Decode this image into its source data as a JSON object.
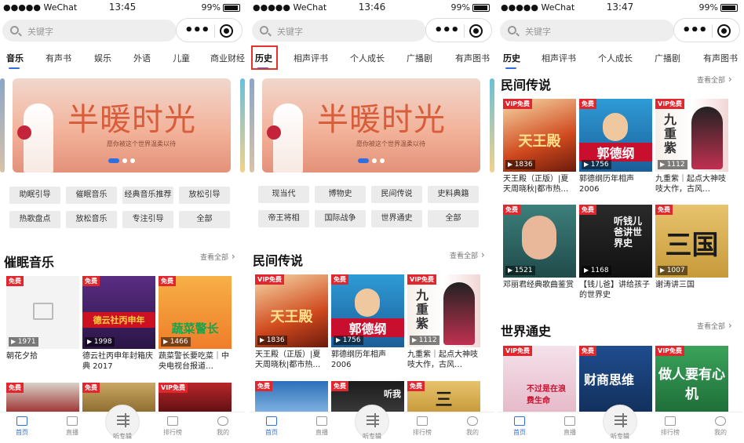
{
  "status": {
    "carrier": "●●●●● WeChat",
    "wifi": "wifi-icon",
    "battery": "99%"
  },
  "screens": [
    {
      "time": "13:45",
      "search_placeholder": "关键字",
      "tabs": [
        "音乐",
        "有声书",
        "娱乐",
        "外语",
        "儿童",
        "商业财经"
      ],
      "active_tab": 0,
      "banner_title": "半暖时光",
      "banner_sub": "愿你被这个世界温柔以待",
      "categories": [
        "助眠引导",
        "催眠音乐",
        "经典音乐推荐",
        "放松引导",
        "热歌盘点",
        "放松音乐",
        "专注引导",
        "全部"
      ],
      "section_title": "催眠音乐",
      "section_more": "查看全部",
      "cards": [
        {
          "badge": "免费",
          "count": "1971",
          "title": "朝花夕拾",
          "cover": "placeholder"
        },
        {
          "badge": "免费",
          "count": "1998",
          "title": "德云社丙申年封箱庆典 2017",
          "cover": "德云社丙申年"
        },
        {
          "badge": "免费",
          "count": "1466",
          "title": "蔬菜警长要吃菜｜中央电视台报道…",
          "cover": "蔬菜警长"
        },
        {
          "badge": "免费",
          "count": "",
          "title": "",
          "cover": ""
        },
        {
          "badge": "免费",
          "count": "",
          "title": "",
          "cover": ""
        },
        {
          "badge": "VIP免费",
          "count": "",
          "title": "",
          "cover": ""
        }
      ]
    },
    {
      "time": "13:46",
      "search_placeholder": "关键字",
      "tabs": [
        "历史",
        "相声评书",
        "个人成长",
        "广播剧",
        "有声图书"
      ],
      "active_tab": 0,
      "banner_title": "半暖时光",
      "banner_sub": "愿你被这个世界温柔以待",
      "categories": [
        "现当代",
        "博物史",
        "民间传说",
        "史料典籍",
        "帝王将相",
        "国际战争",
        "世界通史",
        "全部"
      ],
      "section_title": "民间传说",
      "section_more": "查看全部",
      "cards": [
        {
          "badge": "VIP免费",
          "count": "1836",
          "title": "天王殿（正版）|夏天周晓秋|都市热…",
          "cover": "天王殿"
        },
        {
          "badge": "免费",
          "count": "1756",
          "title": "郭德纲历年相声 2006",
          "cover": "郭德纲"
        },
        {
          "badge": "VIP免费",
          "count": "1112",
          "title": "九重紫｜起点大神吱吱大作，古风…",
          "cover": "九重紫"
        },
        {
          "badge": "免费",
          "count": "",
          "title": "",
          "cover": ""
        },
        {
          "badge": "免费",
          "count": "",
          "title": "",
          "cover": "听我"
        },
        {
          "badge": "免费",
          "count": "",
          "title": "",
          "cover": "三"
        }
      ]
    },
    {
      "time": "13:47",
      "search_placeholder": "关键字",
      "tabs": [
        "历史",
        "相声评书",
        "个人成长",
        "广播剧",
        "有声图书"
      ],
      "active_tab": 0,
      "section_title": "民间传说",
      "section_more": "查看全部",
      "cards": [
        {
          "badge": "VIP免费",
          "count": "1836",
          "title": "天王殿（正版）|夏天周晓秋|都市热…",
          "cover": "天王殿"
        },
        {
          "badge": "免费",
          "count": "1756",
          "title": "郭德纲历年相声 2006",
          "cover": "郭德纲"
        },
        {
          "badge": "VIP免费",
          "count": "1112",
          "title": "九重紫｜起点大神吱吱大作，古风…",
          "cover": "九重紫"
        },
        {
          "badge": "免费",
          "count": "1521",
          "title": "邓丽君经典歌曲鉴赏",
          "cover": "portrait"
        },
        {
          "badge": "免费",
          "count": "1168",
          "title": "【钱儿爸】讲给孩子的世界史",
          "cover": "听钱儿爸讲世界史"
        },
        {
          "badge": "免费",
          "count": "1007",
          "title": "谢涛讲三国",
          "cover": "三国"
        }
      ],
      "section2_title": "世界通史",
      "section2_more": "查看全部",
      "cards2": [
        {
          "badge": "VIP免费",
          "cover": "不过是在浪费生命"
        },
        {
          "badge": "免费",
          "cover": "财商思维"
        },
        {
          "badge": "VIP免费",
          "cover": "做人要有心机"
        }
      ]
    }
  ],
  "tabbar": [
    "首页",
    "直播",
    "听专辑",
    "排行榜",
    "我的"
  ]
}
